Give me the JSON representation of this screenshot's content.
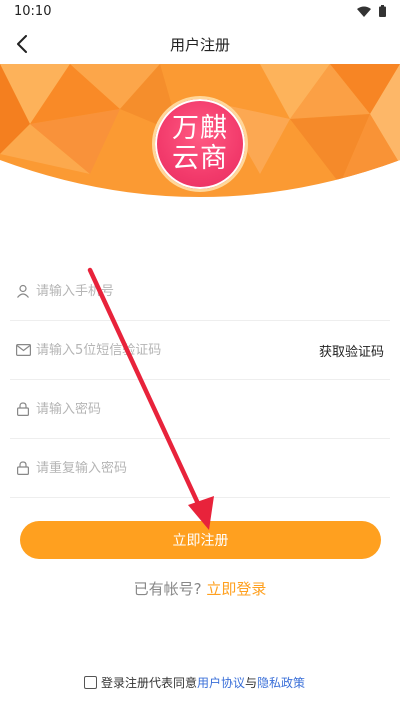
{
  "status_bar": {
    "time": "10:10"
  },
  "nav": {
    "title": "用户注册"
  },
  "logo": {
    "line1": "万麒",
    "line2": "云商"
  },
  "form": {
    "phone_placeholder": "请输入手机号",
    "sms_placeholder": "请输入5位短信验证码",
    "sms_button": "获取验证码",
    "password_placeholder": "请输入密码",
    "confirm_placeholder": "请重复输入密码"
  },
  "submit_label": "立即注册",
  "login": {
    "question": "已有帐号?",
    "link": "立即登录"
  },
  "agreement": {
    "prefix": "登录注册代表同意",
    "user_agreement": "用户协议",
    "and": "与",
    "privacy_policy": "隐私政策"
  },
  "colors": {
    "accent": "#ffa01f",
    "banner": "#fb9a33",
    "logo": "#f23a6b",
    "link": "#3a6fd8",
    "arrow": "#e8233b"
  }
}
